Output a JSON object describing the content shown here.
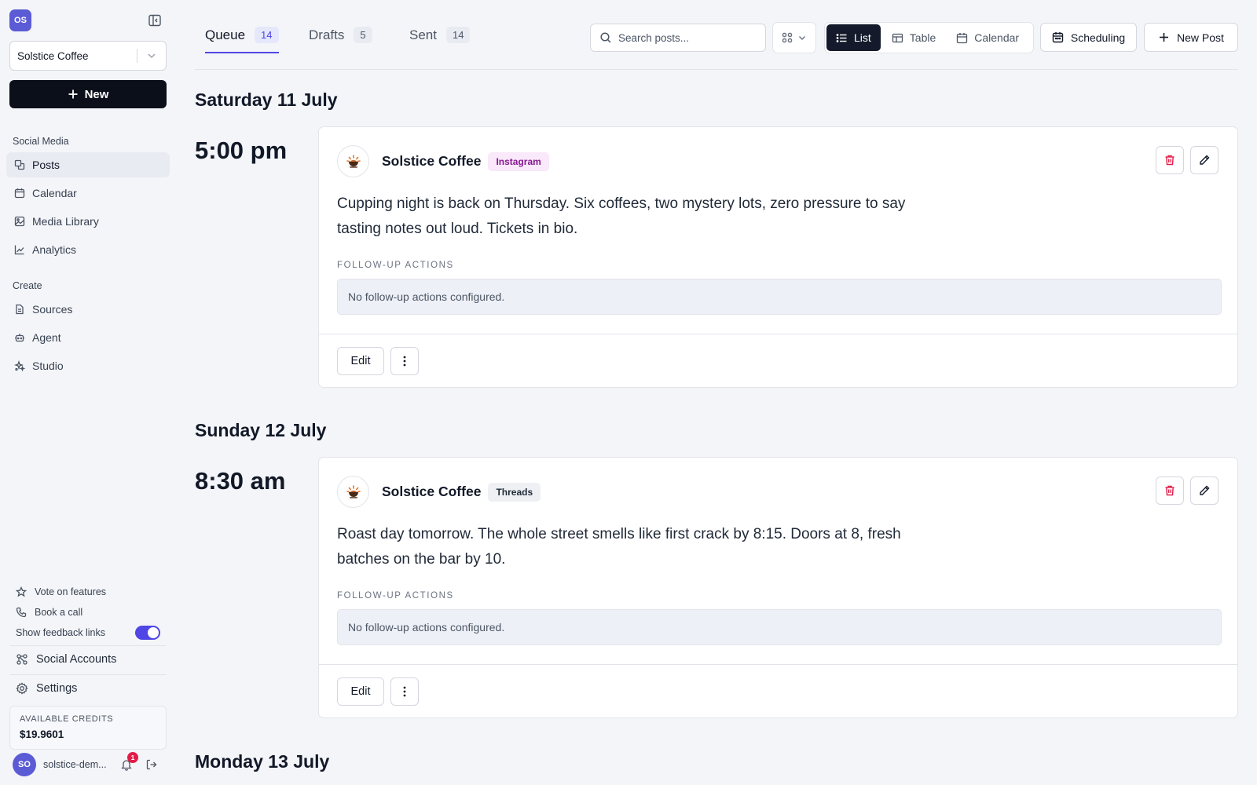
{
  "workspace": {
    "badge": "OS",
    "selected": "Solstice Coffee",
    "new_label": "New"
  },
  "sidebar": {
    "sections": [
      {
        "label": "Social Media",
        "items": [
          {
            "label": "Posts",
            "icon": "posts-icon",
            "active": true
          },
          {
            "label": "Calendar",
            "icon": "calendar-icon"
          },
          {
            "label": "Media Library",
            "icon": "image-icon"
          },
          {
            "label": "Analytics",
            "icon": "chart-icon"
          }
        ]
      },
      {
        "label": "Create",
        "items": [
          {
            "label": "Sources",
            "icon": "document-icon"
          },
          {
            "label": "Agent",
            "icon": "robot-icon"
          },
          {
            "label": "Studio",
            "icon": "sparkles-icon"
          }
        ]
      }
    ],
    "vote_label": "Vote on features",
    "book_label": "Book a call",
    "feedback_toggle_label": "Show feedback links",
    "feedback_toggle_on": true,
    "social_accounts_label": "Social Accounts",
    "settings_label": "Settings",
    "credits_label": "AVAILABLE CREDITS",
    "credits_value": "$19.9601",
    "user_initials": "SO",
    "user_name": "solstice-dem...",
    "notification_count": "1"
  },
  "tabs": [
    {
      "label": "Queue",
      "count": "14",
      "active": true
    },
    {
      "label": "Drafts",
      "count": "5"
    },
    {
      "label": "Sent",
      "count": "14"
    }
  ],
  "toolbar": {
    "search_placeholder": "Search posts...",
    "views": [
      {
        "label": "List",
        "icon": "list-icon",
        "active": true
      },
      {
        "label": "Table",
        "icon": "table-icon"
      },
      {
        "label": "Calendar",
        "icon": "calendar-icon"
      }
    ],
    "scheduling_label": "Scheduling",
    "new_post_label": "New Post"
  },
  "days": [
    {
      "heading": "Saturday 11 July",
      "posts": [
        {
          "time": "5:00 pm",
          "account": "Solstice Coffee",
          "platform": "Instagram",
          "body": "Cupping night is back on Thursday. Six coffees, two mystery lots, zero pressure to say tasting notes out loud. Tickets in bio.",
          "followup_label": "FOLLOW-UP ACTIONS",
          "followup_text": "No follow-up actions configured.",
          "edit_label": "Edit"
        }
      ]
    },
    {
      "heading": "Sunday 12 July",
      "posts": [
        {
          "time": "8:30 am",
          "account": "Solstice Coffee",
          "platform": "Threads",
          "body": "Roast day tomorrow. The whole street smells like first crack by 8:15. Doors at 8, fresh batches on the bar by 10.",
          "followup_label": "FOLLOW-UP ACTIONS",
          "followup_text": "No follow-up actions configured.",
          "edit_label": "Edit"
        }
      ]
    },
    {
      "heading": "Monday 13 July",
      "posts": []
    }
  ],
  "colors": {
    "accent": "#4f46e5",
    "primary_dark": "#0b0f1a",
    "delete_red": "#e11d48",
    "instagram_chip": "#fae8fb",
    "threads_chip": "#eef0f3"
  }
}
